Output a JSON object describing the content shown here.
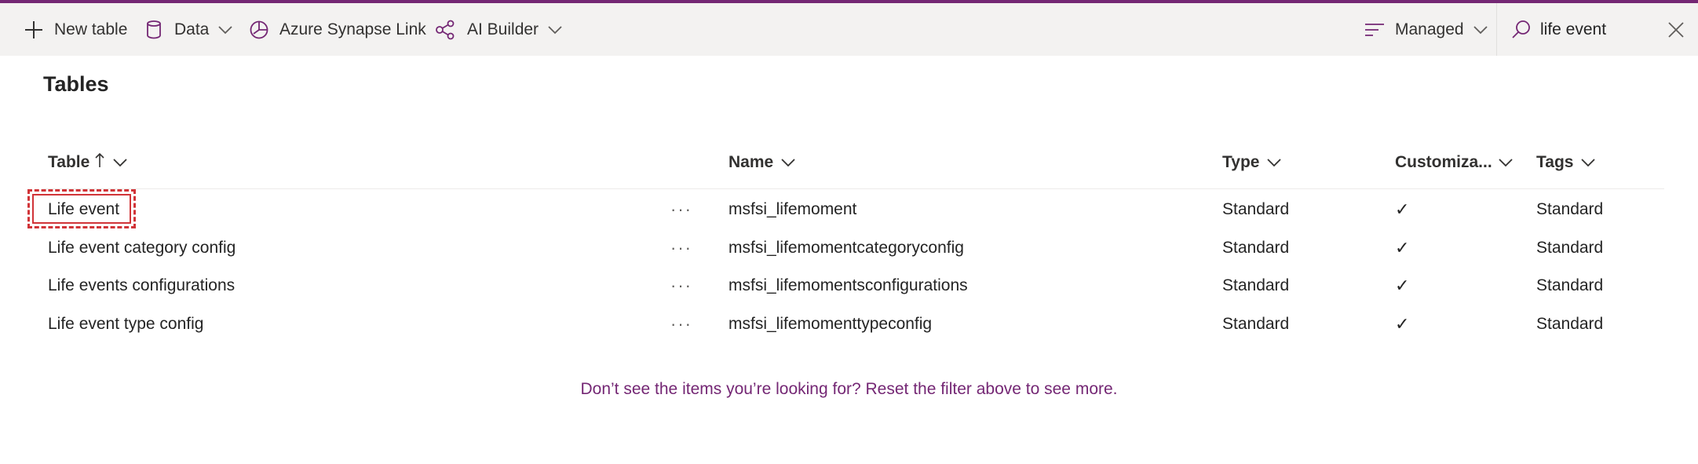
{
  "toolbar": {
    "new_table_label": "New table",
    "data_label": "Data",
    "synapse_label": "Azure Synapse Link",
    "ai_builder_label": "AI Builder",
    "filter_label": "Managed",
    "search": {
      "value": "life event",
      "placeholder": "Search"
    }
  },
  "page": {
    "title": "Tables"
  },
  "table": {
    "columns": {
      "table": "Table",
      "name": "Name",
      "type": "Type",
      "customizable": "Customiza...",
      "tags": "Tags"
    },
    "sort": {
      "column": "Table",
      "direction": "ascending"
    },
    "more_label": "···",
    "rows": [
      {
        "table": "Life event",
        "name": "msfsi_lifemoment",
        "type": "Standard",
        "customizable": "✓",
        "tags": "Standard"
      },
      {
        "table": "Life event category config",
        "name": "msfsi_lifemomentcategoryconfig",
        "type": "Standard",
        "customizable": "✓",
        "tags": "Standard"
      },
      {
        "table": "Life events configurations",
        "name": "msfsi_lifemomentsconfigurations",
        "type": "Standard",
        "customizable": "✓",
        "tags": "Standard"
      },
      {
        "table": "Life event type config",
        "name": "msfsi_lifemomenttypeconfig",
        "type": "Standard",
        "customizable": "✓",
        "tags": "Standard"
      }
    ]
  },
  "footer": {
    "message": "Don’t see the items you’re looking for? Reset the filter above to see more."
  },
  "colors": {
    "accent": "#742774",
    "toolbar_bg": "#f3f2f1",
    "focus": "#d13438"
  },
  "icons": {
    "new_table": "plus-icon",
    "data": "database-icon",
    "synapse": "synapse-icon",
    "ai_builder": "ai-builder-icon",
    "filter": "filter-lines-icon",
    "search": "search-icon",
    "close": "close-icon"
  }
}
